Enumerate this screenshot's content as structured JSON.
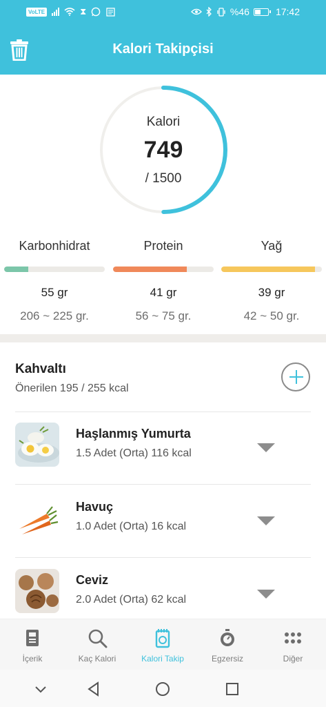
{
  "status_bar": {
    "volte": "VoLTE",
    "battery_text": "%46",
    "time": "17:42",
    "battery_level": 0.46
  },
  "header": {
    "title": "Kalori Takipçisi",
    "trash_icon": "trash-icon"
  },
  "calories": {
    "label": "Kalori",
    "value": "749",
    "goal": "/ 1500",
    "progress": 0.4993,
    "ring_color": "#3fc1dc"
  },
  "macros": [
    {
      "name": "Karbonhidrat",
      "value": "55 gr",
      "range": "206 ~ 225 gr.",
      "progress": 0.24,
      "color": "#7cc6a9"
    },
    {
      "name": "Protein",
      "value": "41 gr",
      "range": "56 ~ 75 gr.",
      "progress": 0.73,
      "color": "#f0895a"
    },
    {
      "name": "Yağ",
      "value": "39 gr",
      "range": "42 ~ 50 gr.",
      "progress": 0.93,
      "color": "#f6c75c"
    }
  ],
  "meal": {
    "title": "Kahvaltı",
    "subtitle": "Önerilen 195 / 255 kcal",
    "add_icon": "plus-circle-icon",
    "items": [
      {
        "name": "Haşlanmış Yumurta",
        "detail": "1.5 Adet (Orta) 116 kcal",
        "image": "boiled-egg-image"
      },
      {
        "name": "Havuç",
        "detail": "1.0 Adet (Orta) 16 kcal",
        "image": "carrot-image"
      },
      {
        "name": "Ceviz",
        "detail": "2.0 Adet (Orta) 62 kcal",
        "image": "walnut-image"
      }
    ]
  },
  "bottom_nav": [
    {
      "label": "İçerik",
      "icon": "book-icon",
      "active": false
    },
    {
      "label": "Kaç Kalori",
      "icon": "search-icon",
      "active": false
    },
    {
      "label": "Kalori Takip",
      "icon": "tracker-icon",
      "active": true
    },
    {
      "label": "Egzersiz",
      "icon": "stopwatch-icon",
      "active": false
    },
    {
      "label": "Diğer",
      "icon": "more-grid-icon",
      "active": false
    }
  ],
  "colors": {
    "accent": "#3fc1dc",
    "inactive": "#7d7d7d"
  }
}
